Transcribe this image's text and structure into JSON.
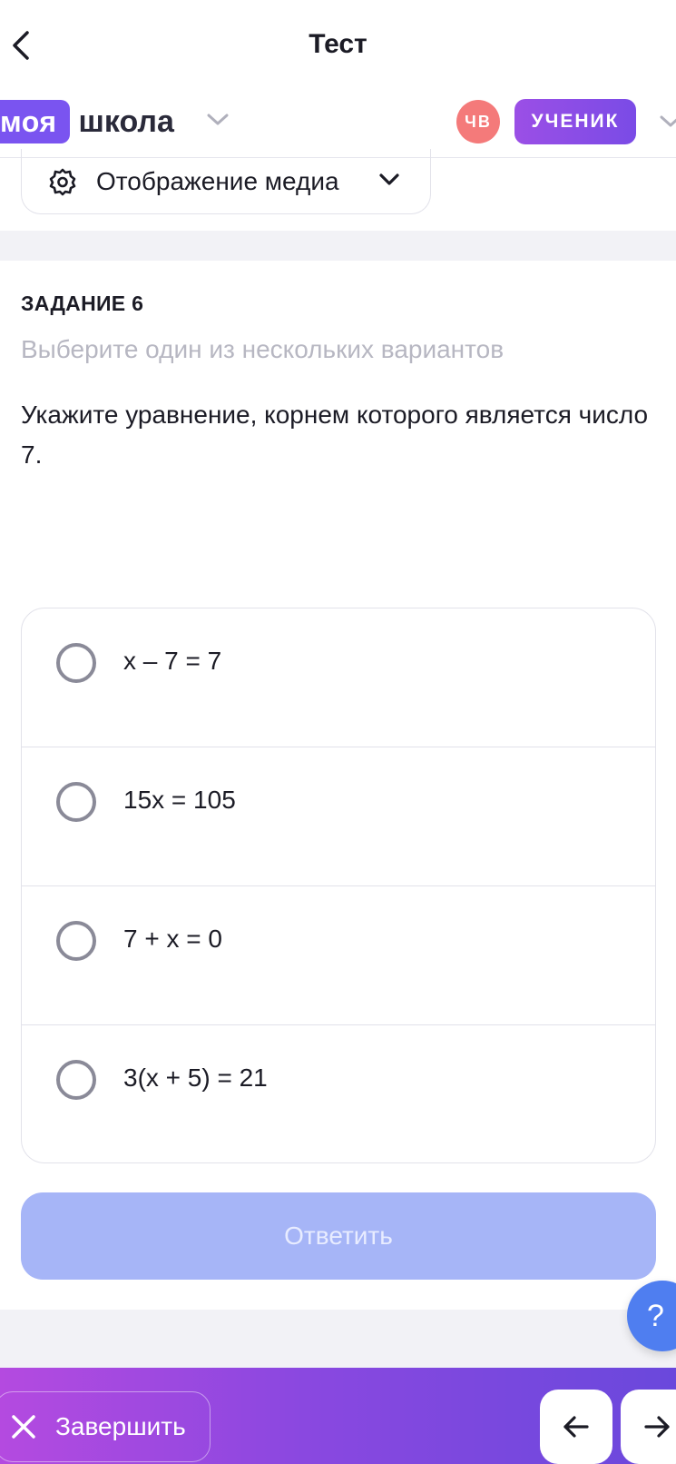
{
  "header": {
    "title": "Тест",
    "back_icon": "chevron-left-icon"
  },
  "school": {
    "logo_part1": "моя",
    "logo_part2": "школа",
    "avatar_initials": "ЧВ",
    "role": "УЧЕНИК",
    "colors": {
      "logo": "#7a54f0",
      "avatar": "#f47a7a",
      "role": "#8a4be6"
    }
  },
  "media": {
    "label": "Отображение медиа",
    "icon": "settings-gear-icon"
  },
  "task": {
    "number_label": "ЗАДАНИЕ 6",
    "hint": "Выберите один из нескольких вариантов",
    "question": "Укажите уравнение, корнем которого является число 7.",
    "options": [
      {
        "label": "x – 7 = 7",
        "selected": false
      },
      {
        "label": "15x = 105",
        "selected": false
      },
      {
        "label": "7 + x = 0",
        "selected": false
      },
      {
        "label": "3(x + 5) = 21",
        "selected": false
      }
    ],
    "answer_button": "Ответить"
  },
  "help": {
    "label": "?"
  },
  "footer": {
    "finish_label": "Завершить",
    "prev_icon": "arrow-left-icon",
    "next_icon": "arrow-right-icon"
  }
}
